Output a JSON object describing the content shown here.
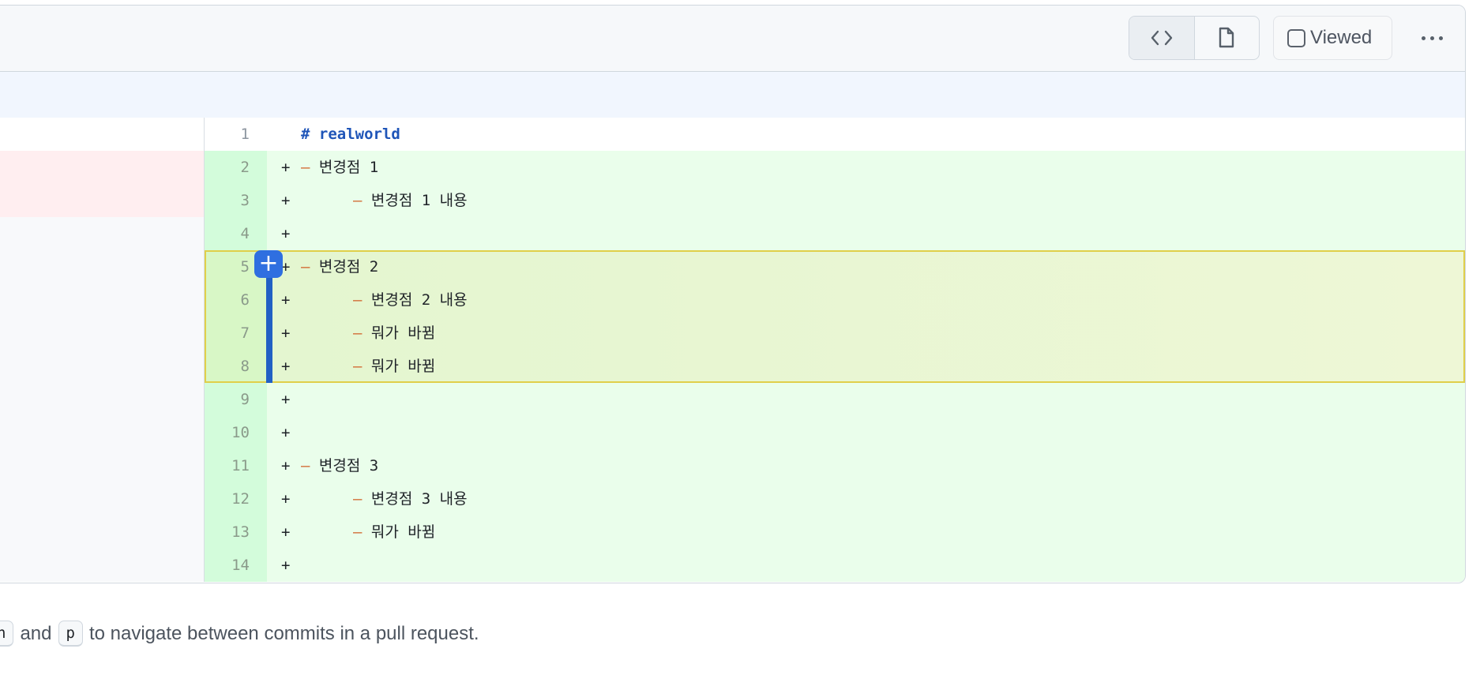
{
  "header": {
    "code_view_icon": "code-icon",
    "file_view_icon": "file-icon",
    "viewed_label": "Viewed",
    "more_icon": "kebab-horizontal-icon"
  },
  "lines": [
    {
      "n": "1",
      "marker": "",
      "indent": 0,
      "dash": "",
      "text": "# realworld",
      "type": "ctx",
      "left": "ctx"
    },
    {
      "n": "2",
      "marker": "+",
      "indent": 0,
      "dash": "–",
      "text": "변경점 1",
      "type": "add",
      "left": "del"
    },
    {
      "n": "3",
      "marker": "+",
      "indent": 1,
      "dash": "–",
      "text": "변경점 1 내용",
      "type": "add",
      "left": "del"
    },
    {
      "n": "4",
      "marker": "+",
      "indent": 0,
      "dash": "",
      "text": "",
      "type": "add",
      "left": "empty"
    },
    {
      "n": "5",
      "marker": "+",
      "indent": 0,
      "dash": "–",
      "text": "변경점 2",
      "type": "add",
      "left": "empty",
      "hl": true
    },
    {
      "n": "6",
      "marker": "+",
      "indent": 1,
      "dash": "–",
      "text": "변경점 2 내용",
      "type": "add",
      "left": "empty",
      "hl": true
    },
    {
      "n": "7",
      "marker": "+",
      "indent": 1,
      "dash": "–",
      "text": "뭐가 바뀜",
      "type": "add",
      "left": "empty",
      "hl": true
    },
    {
      "n": "8",
      "marker": "+",
      "indent": 1,
      "dash": "–",
      "text": "뭐가 바뀜",
      "type": "add",
      "left": "empty",
      "hl": true
    },
    {
      "n": "9",
      "marker": "+",
      "indent": 0,
      "dash": "",
      "text": "",
      "type": "add",
      "left": "empty"
    },
    {
      "n": "10",
      "marker": "+",
      "indent": 0,
      "dash": "",
      "text": "",
      "type": "add",
      "left": "empty"
    },
    {
      "n": "11",
      "marker": "+",
      "indent": 0,
      "dash": "–",
      "text": "변경점 3",
      "type": "add",
      "left": "empty"
    },
    {
      "n": "12",
      "marker": "+",
      "indent": 1,
      "dash": "–",
      "text": "변경점 3 내용",
      "type": "add",
      "left": "empty"
    },
    {
      "n": "13",
      "marker": "+",
      "indent": 1,
      "dash": "–",
      "text": "뭐가 바뀜",
      "type": "add",
      "left": "empty"
    },
    {
      "n": "14",
      "marker": "+",
      "indent": 0,
      "dash": "",
      "text": "",
      "type": "add",
      "left": "empty"
    }
  ],
  "add_comment_label": "+",
  "footer": {
    "key_n": "n",
    "and": "and",
    "key_p": "p",
    "text": "to navigate between commits in a pull request."
  }
}
